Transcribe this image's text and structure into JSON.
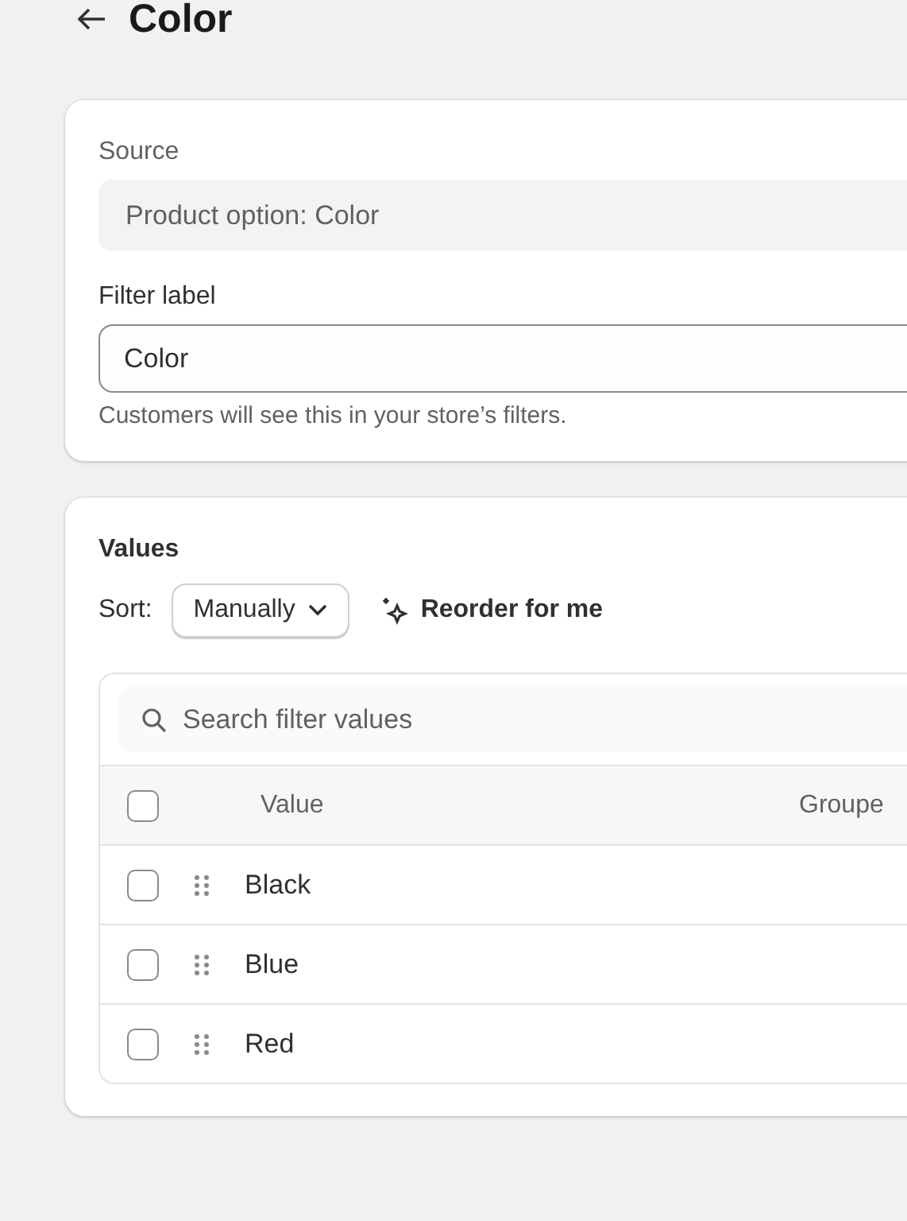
{
  "header": {
    "title": "Color"
  },
  "source": {
    "label": "Source",
    "value": "Product option: Color"
  },
  "filter_label": {
    "label": "Filter label",
    "value": "Color",
    "help": "Customers will see this in your store’s filters."
  },
  "values": {
    "title": "Values",
    "sort_label": "Sort:",
    "sort_value": "Manually",
    "reorder": "Reorder for me",
    "search": {
      "placeholder": "Search filter values"
    },
    "header_checked": false,
    "columns": [
      "Value",
      "Groupe"
    ],
    "rows": [
      {
        "value": "Black",
        "checked": false
      },
      {
        "value": "Blue",
        "checked": false
      },
      {
        "value": "Red",
        "checked": false
      }
    ]
  }
}
